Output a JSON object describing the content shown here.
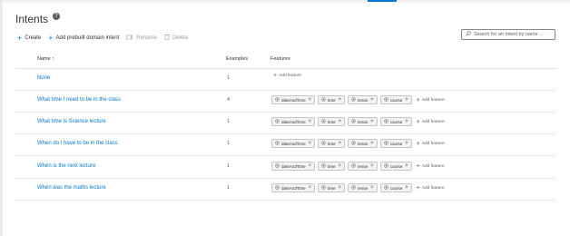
{
  "page": {
    "title": "Intents",
    "help_icon": "?"
  },
  "toolbar": {
    "create_label": "Create",
    "add_prebuilt_label": "Add prebuilt domain intent",
    "rename_label": "Rename",
    "delete_label": "Delete"
  },
  "search": {
    "placeholder": "Search for an intent by name ..."
  },
  "table": {
    "headers": {
      "name": "Name ↑",
      "examples": "Examples",
      "features": "Features"
    },
    "add_feature_label": "Add feature",
    "rows": [
      {
        "name": "None",
        "examples": "1",
        "features": []
      },
      {
        "name": "What time I need to be in the class",
        "examples": "4",
        "features": [
          "dateAndTime",
          "time",
          "tense",
          "course"
        ]
      },
      {
        "name": "What time is Science lecture",
        "examples": "1",
        "features": [
          "dateAndTime",
          "time",
          "tense",
          "course"
        ]
      },
      {
        "name": "When do I have to be in the class",
        "examples": "1",
        "features": [
          "dateAndTime",
          "time",
          "tense",
          "course"
        ]
      },
      {
        "name": "When is the next lecture",
        "examples": "1",
        "features": [
          "dateAndTime",
          "time",
          "tense",
          "course"
        ]
      },
      {
        "name": "When was the maths lecture",
        "examples": "1",
        "features": [
          "dateAndTime",
          "time",
          "tense",
          "course"
        ]
      }
    ]
  },
  "colors": {
    "accent": "#0078d4",
    "text": "#323130",
    "muted": "#605e5c",
    "disabled": "#a19f9d"
  }
}
